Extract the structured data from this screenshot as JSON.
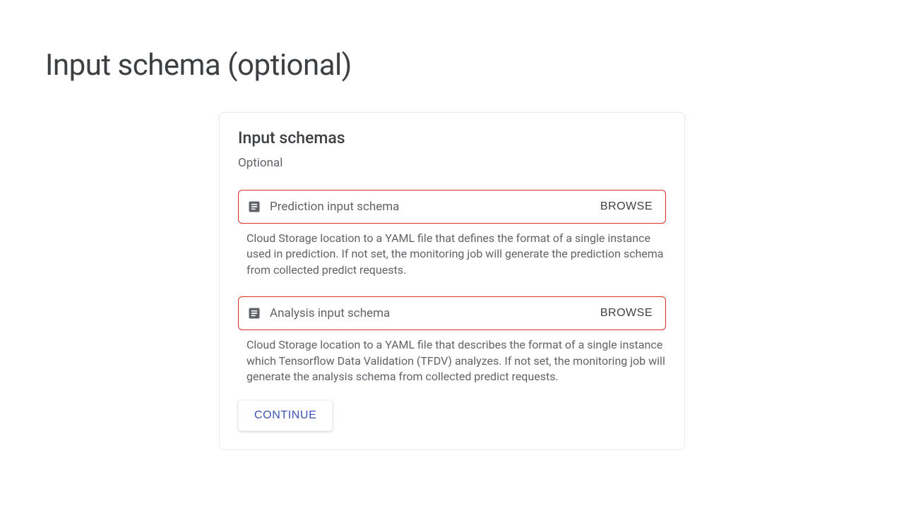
{
  "page": {
    "title": "Input schema (optional)"
  },
  "card": {
    "heading": "Input schemas",
    "sub": "Optional",
    "fields": [
      {
        "placeholder": "Prediction input schema",
        "browse": "BROWSE",
        "helper": "Cloud Storage location to a YAML file that defines the format of a single instance used in prediction. If not set, the monitoring job will generate the prediction schema from collected predict requests."
      },
      {
        "placeholder": "Analysis input schema",
        "browse": "BROWSE",
        "helper": "Cloud Storage location to a YAML file that describes the format of a single instance which Tensorflow Data Validation (TFDV) analyzes. If not set, the monitoring job will generate the analysis schema from collected predict requests."
      }
    ],
    "continue": "CONTINUE"
  }
}
